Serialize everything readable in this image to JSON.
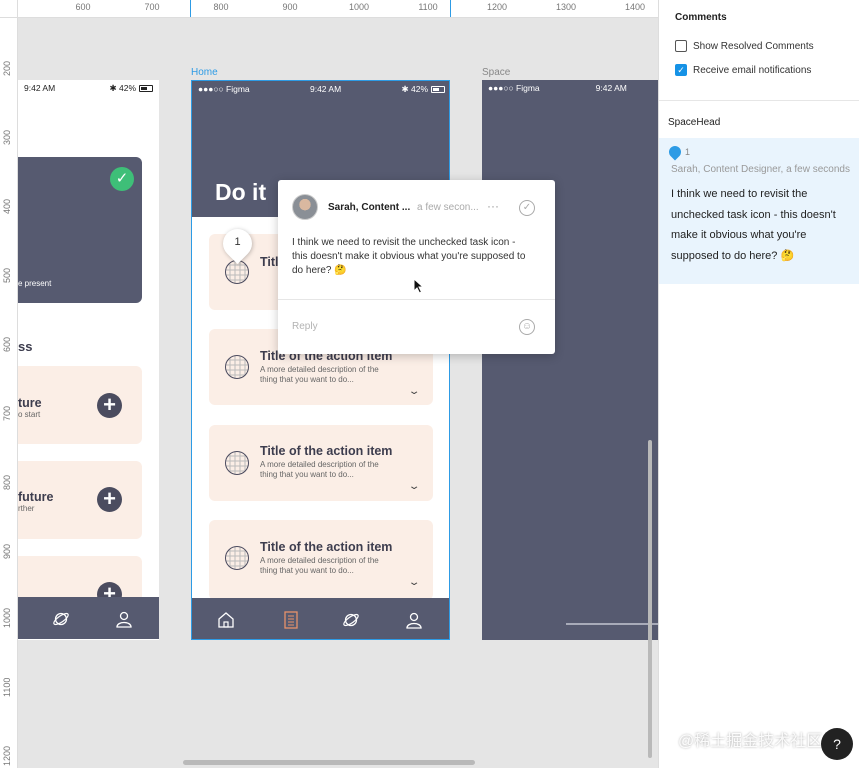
{
  "ruler": {
    "x_ticks": [
      "600",
      "700",
      "800",
      "900",
      "1000",
      "1100",
      "1200",
      "1300",
      "1400"
    ],
    "y_ticks": [
      "200",
      "300",
      "400",
      "500",
      "600",
      "700",
      "800",
      "900",
      "1000",
      "1100",
      "1200"
    ]
  },
  "frames": {
    "home_label": "Home",
    "space_label": "Space",
    "active_color": "#2d9be5"
  },
  "left_phone": {
    "time": "9:42 AM",
    "battery": "42%",
    "present_text": "e present",
    "section_heading": "ss",
    "cards": [
      {
        "title": "ture",
        "desc": "o start"
      },
      {
        "title": "future",
        "desc": "rther"
      },
      {
        "title": "",
        "desc": ""
      }
    ]
  },
  "home_phone": {
    "carrier": "●●●○○ Figma",
    "time": "9:42 AM",
    "battery": "42%",
    "heading": "Do it",
    "first_card_title": "Title",
    "first_card_desc": "A m\nthe t",
    "cards": [
      {
        "title": "Title of the action item",
        "desc": "A more detailed description of the thing that you want to do..."
      },
      {
        "title": "Title of the action item",
        "desc": "A more detailed description of the thing that you want to do..."
      },
      {
        "title": "Title of the action item",
        "desc": "A more detailed description of the thing that you want to do..."
      }
    ],
    "header_color": "#565a70",
    "card_color": "#fbeee6"
  },
  "space_phone": {
    "carrier": "●●●○○ Figma",
    "time": "9:42 AM"
  },
  "comment_popup": {
    "author": "Sarah, Content ...",
    "when": "a few secon...",
    "more": "···",
    "resolve_icon": "✓",
    "body": "I think we need to revisit the unchecked task icon - this doesn't make it obvious what you're supposed to do here? 🤔",
    "reply_placeholder": "Reply",
    "emoji_icon": "☺",
    "pin_number": "1"
  },
  "panel": {
    "title": "Comments",
    "options": [
      {
        "label": "Show Resolved Comments",
        "checked": false
      },
      {
        "label": "Receive email notifications",
        "checked": true
      }
    ],
    "page_name": "SpaceHead",
    "thread": {
      "number": "1",
      "byline": "Sarah, Content Designer, a few seconds",
      "text": "I think we need to revisit the unchecked task icon - this doesn't make it obvious what you're supposed to do here? 🤔"
    }
  },
  "help_label": "?",
  "watermark": "@稀土掘金技术社区"
}
